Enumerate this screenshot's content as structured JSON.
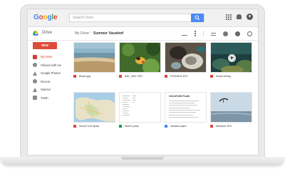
{
  "google": {
    "logo_letters": [
      {
        "ch": "G",
        "color": "#4285f4"
      },
      {
        "ch": "o",
        "color": "#ea4335"
      },
      {
        "ch": "o",
        "color": "#fbbc05"
      },
      {
        "ch": "g",
        "color": "#4285f4"
      },
      {
        "ch": "l",
        "color": "#34a853"
      },
      {
        "ch": "e",
        "color": "#ea4335"
      }
    ],
    "search_placeholder": "Search Drive",
    "icons": [
      "apps-icon",
      "bell-icon",
      "account-avatar"
    ]
  },
  "drive": {
    "title": "Drive",
    "breadcrumb_root": "My Drive",
    "breadcrumb_sep": "›",
    "breadcrumb_current": "Summer Vacation",
    "breadcrumb_caret": "▾"
  },
  "sidebar": {
    "new_label": "NEW",
    "items": [
      {
        "label": "My Drive",
        "icon": "folder-icon",
        "active": true
      },
      {
        "label": "Shared with me",
        "icon": "people-icon",
        "active": false
      },
      {
        "label": "Google Photos",
        "icon": "photos-icon",
        "active": false
      },
      {
        "label": "Recent",
        "icon": "clock-icon",
        "active": false
      },
      {
        "label": "Starred",
        "icon": "star-icon",
        "active": false
      },
      {
        "label": "Trash",
        "icon": "trash-icon",
        "active": false
      }
    ]
  },
  "files": [
    {
      "name": "Beach.jpg",
      "type": "image"
    },
    {
      "name": "IMG_4057.JPG",
      "type": "image"
    },
    {
      "name": "P1020514.JPG",
      "type": "image"
    },
    {
      "name": "Scuba diving",
      "type": "video"
    },
    {
      "name": "Secret Surf Spots",
      "type": "image"
    },
    {
      "name": "Stuff to pack",
      "type": "sheet"
    },
    {
      "name": "Vacation plan!",
      "type": "doc"
    },
    {
      "name": "Windsurf.JPG",
      "type": "image"
    }
  ],
  "doc_preview": {
    "heading": "VACATION PLAN"
  },
  "colors": {
    "accent_red": "#dd4b39",
    "search_blue": "#4a8af4"
  }
}
